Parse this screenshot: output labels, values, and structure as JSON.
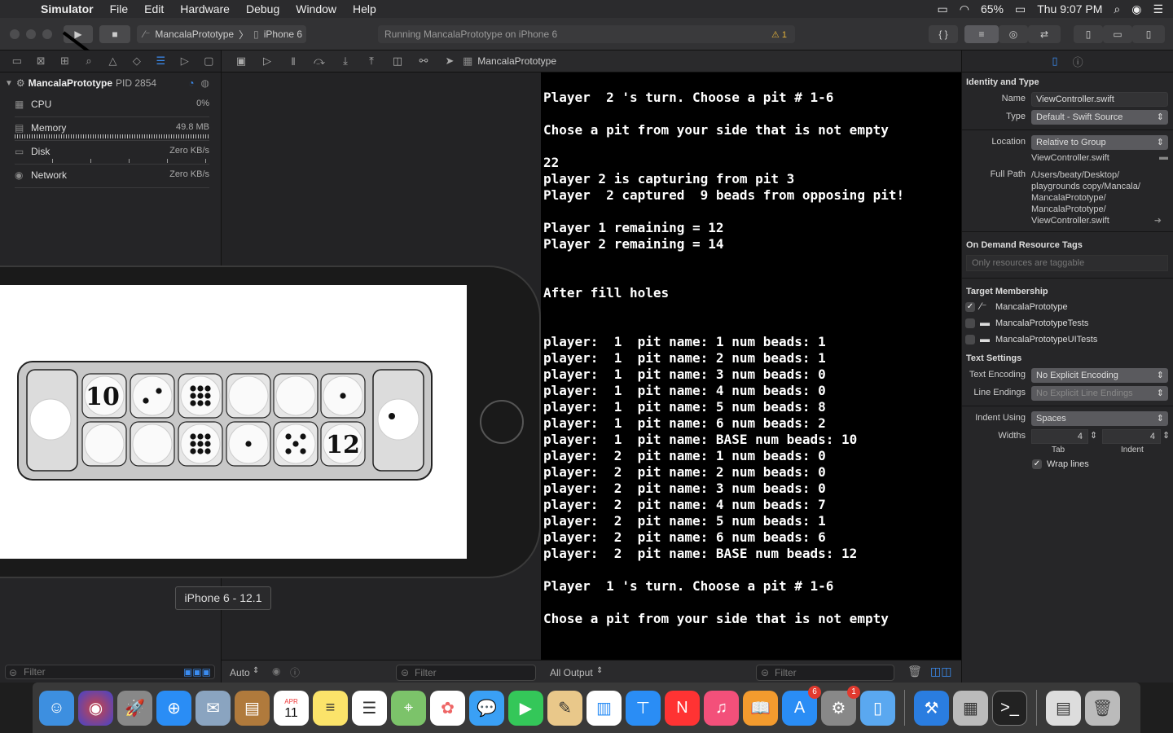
{
  "menubar": {
    "apple": "",
    "app_name": "Simulator",
    "items": [
      "File",
      "Edit",
      "Hardware",
      "Debug",
      "Window",
      "Help"
    ],
    "battery": "65%",
    "clock": "Thu 9:07 PM"
  },
  "toolbar": {
    "scheme_project": "MancalaPrototype",
    "scheme_device": "iPhone 6",
    "activity": "Running MancalaPrototype on iPhone 6",
    "warnings": "1"
  },
  "navigator": {
    "process_name": "MancalaPrototype",
    "process_pid": "PID 2854",
    "gauges": [
      {
        "label": "CPU",
        "value": "0%"
      },
      {
        "label": "Memory",
        "value": "49.8 MB"
      },
      {
        "label": "Disk",
        "value": "Zero KB/s"
      },
      {
        "label": "Network",
        "value": "Zero KB/s"
      }
    ],
    "filter_placeholder": "Filter"
  },
  "debugbar": {
    "project": "MancalaPrototype"
  },
  "variables": {
    "scope": "Auto",
    "filter_placeholder": "Filter"
  },
  "console": {
    "output_mode": "All Output",
    "filter_placeholder": "Filter",
    "lines": [
      "Player  2 's turn. Choose a pit # 1-6",
      "",
      "Chose a pit from your side that is not empty",
      "",
      "22",
      "player 2 is capturing from pit 3",
      "Player  2 captured  9 beads from opposing pit!",
      "",
      "Player 1 remaining = 12",
      "Player 2 remaining = 14",
      "",
      "",
      "After fill holes",
      "",
      "",
      "player:  1  pit name: 1 num beads: 1",
      "player:  1  pit name: 2 num beads: 1",
      "player:  1  pit name: 3 num beads: 0",
      "player:  1  pit name: 4 num beads: 0",
      "player:  1  pit name: 5 num beads: 8",
      "player:  1  pit name: 6 num beads: 2",
      "player:  1  pit name: BASE num beads: 10",
      "player:  2  pit name: 1 num beads: 0",
      "player:  2  pit name: 2 num beads: 0",
      "player:  2  pit name: 3 num beads: 0",
      "player:  2  pit name: 4 num beads: 7",
      "player:  2  pit name: 5 num beads: 1",
      "player:  2  pit name: 6 num beads: 6",
      "player:  2  pit name: BASE num beads: 12",
      "",
      "Player  1 's turn. Choose a pit # 1-6",
      "",
      "Chose a pit from your side that is not empty"
    ]
  },
  "inspector": {
    "identity_title": "Identity and Type",
    "name_label": "Name",
    "name_value": "ViewController.swift",
    "type_label": "Type",
    "type_value": "Default - Swift Source",
    "location_label": "Location",
    "location_value": "Relative to Group",
    "location_file": "ViewController.swift",
    "fullpath_label": "Full Path",
    "fullpath_lines": [
      "/Users/beaty/Desktop/",
      "playgrounds copy/Mancala/",
      "MancalaPrototype/",
      "MancalaPrototype/",
      "ViewController.swift"
    ],
    "tags_title": "On Demand Resource Tags",
    "tags_placeholder": "Only resources are taggable",
    "membership_title": "Target Membership",
    "targets": [
      {
        "name": "MancalaPrototype",
        "checked": true
      },
      {
        "name": "MancalaPrototypeTests",
        "checked": false
      },
      {
        "name": "MancalaPrototypeUITests",
        "checked": false
      }
    ],
    "text_title": "Text Settings",
    "encoding_label": "Text Encoding",
    "encoding_value": "No Explicit Encoding",
    "endings_label": "Line Endings",
    "endings_value": "No Explicit Line Endings",
    "indent_label": "Indent Using",
    "indent_value": "Spaces",
    "widths_label": "Widths",
    "tab_value": "4",
    "indent_width_value": "4",
    "tab_caption": "Tab",
    "indent_caption": "Indent",
    "wrap_label": "Wrap lines"
  },
  "simulator": {
    "device_tooltip": "iPhone 6 - 12.1",
    "mancala": {
      "left_store_beads": 0,
      "right_store_beads": 1,
      "top_row_label": "10",
      "top_row_beads": [
        null,
        2,
        9,
        0,
        0,
        1
      ],
      "bottom_row_label": "12",
      "bottom_row_beads": [
        0,
        0,
        9,
        1,
        5,
        null
      ]
    }
  },
  "dock": {
    "calendar_month": "APR",
    "calendar_day": "11",
    "appstore_badge": "6",
    "prefs_badge": "1"
  }
}
